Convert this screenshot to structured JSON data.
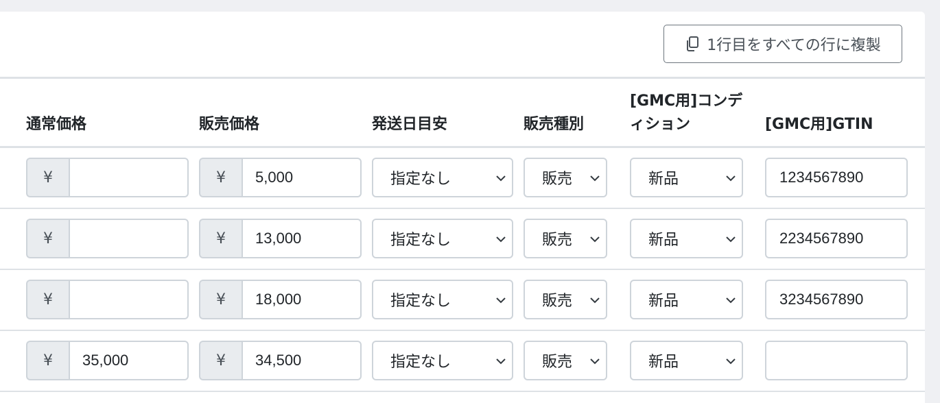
{
  "toolbar": {
    "copy_first_row_label": "1行目をすべての行に複製"
  },
  "columns": {
    "regular_price": "通常価格",
    "sale_price": "販売価格",
    "shipping_estimate": "発送日目安",
    "sale_type": "販売種別",
    "gmc_condition_line1": "[GMC用]コンデ",
    "gmc_condition_line2": "ィション",
    "gmc_gtin": "[GMC用]GTIN"
  },
  "currency_symbol": "¥",
  "rows": [
    {
      "regular_price": "",
      "sale_price": "5,000",
      "shipping_estimate": "指定なし",
      "sale_type": "販売",
      "condition": "新品",
      "gtin": "1234567890"
    },
    {
      "regular_price": "",
      "sale_price": "13,000",
      "shipping_estimate": "指定なし",
      "sale_type": "販売",
      "condition": "新品",
      "gtin": "2234567890"
    },
    {
      "regular_price": "",
      "sale_price": "18,000",
      "shipping_estimate": "指定なし",
      "sale_type": "販売",
      "condition": "新品",
      "gtin": "3234567890"
    },
    {
      "regular_price": "35,000",
      "sale_price": "34,500",
      "shipping_estimate": "指定なし",
      "sale_type": "販売",
      "condition": "新品",
      "gtin": ""
    }
  ],
  "colors": {
    "border": "#ced4da",
    "addon_bg": "#e9ecef",
    "page_bg": "#eff0f3"
  }
}
